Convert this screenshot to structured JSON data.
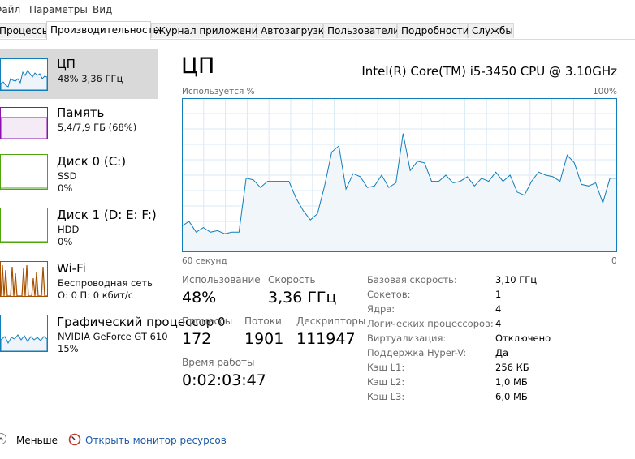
{
  "menubar": {
    "items": [
      "Файл",
      "Параметры",
      "Вид"
    ]
  },
  "tabs": [
    "Процессы",
    "Производительность",
    "Журнал приложений",
    "Автозагрузка",
    "Пользователи",
    "Подробности",
    "Службы"
  ],
  "sidebar": {
    "items": [
      {
        "title": "ЦП",
        "line1": "48% 3,36 ГГц",
        "line2": ""
      },
      {
        "title": "Память",
        "line1": "5,4/7,9 ГБ (68%)",
        "line2": ""
      },
      {
        "title": "Диск 0 (C:)",
        "line1": "SSD",
        "line2": "0%"
      },
      {
        "title": "Диск 1 (D: E: F:)",
        "line1": "HDD",
        "line2": "0%"
      },
      {
        "title": "Wi-Fi",
        "line1": "Беспроводная сеть",
        "line2": "О: 0 П: 0 кбит/с"
      },
      {
        "title": "Графический процессор 0",
        "line1": "NVIDIA GeForce GT 610",
        "line2": "15%"
      }
    ]
  },
  "main": {
    "title": "ЦП",
    "cpu_name": "Intel(R) Core(TM) i5-3450 CPU @ 3.10GHz",
    "chart_label_left": "Используется %",
    "chart_label_right": "100%",
    "chart_time_left": "60 секунд",
    "chart_time_right": "0"
  },
  "stats": {
    "usage_label": "Использование",
    "usage_value": "48%",
    "speed_label": "Скорость",
    "speed_value": "3,36 ГГц",
    "processes_label": "Процессы",
    "processes_value": "172",
    "threads_label": "Потоки",
    "threads_value": "1901",
    "handles_label": "Дескрипторы",
    "handles_value": "111947",
    "uptime_label": "Время работы",
    "uptime_value": "0:02:03:47"
  },
  "details": [
    {
      "key": "Базовая скорость:",
      "value": "3,10 ГГц"
    },
    {
      "key": "Сокетов:",
      "value": "1"
    },
    {
      "key": "Ядра:",
      "value": "4"
    },
    {
      "key": "Логических процессоров:",
      "value": "4"
    },
    {
      "key": "Виртуализация:",
      "value": "Отключено"
    },
    {
      "key": "Поддержка Hyper-V:",
      "value": "Да"
    },
    {
      "key": "Кэш L1:",
      "value": "256 КБ"
    },
    {
      "key": "Кэш L2:",
      "value": "1,0 МБ"
    },
    {
      "key": "Кэш L3:",
      "value": "6,0 МБ"
    }
  ],
  "bottom": {
    "less_label": "Меньше",
    "monitor_label": "Открыть монитор ресурсов"
  },
  "colors": {
    "cpu": "#117dbb",
    "cpu_fill": "#f1f6fa",
    "grid": "#d9eaf4",
    "memory": "#8b12ae",
    "disk": "#4da60c",
    "wifi": "#a74f01",
    "link": "#1a5aa6"
  },
  "chart_data": {
    "type": "area",
    "xlim": [
      60,
      0
    ],
    "ylim": [
      0,
      100
    ],
    "grid": true,
    "values": [
      17,
      20,
      13,
      16,
      13,
      14,
      12,
      13,
      13,
      48,
      47,
      42,
      46,
      46,
      46,
      46,
      35,
      27,
      21,
      25,
      43,
      65,
      69,
      41,
      51,
      49,
      42,
      43,
      50,
      42,
      45,
      77,
      53,
      59,
      58,
      46,
      46,
      50,
      45,
      46,
      49,
      43,
      48,
      46,
      52,
      46,
      50,
      39,
      37,
      46,
      52,
      50,
      49,
      46,
      63,
      58,
      44,
      43,
      45,
      32,
      48,
      48
    ]
  },
  "icons": {
    "less": "chevron-up-icon",
    "monitor": "resource-monitor-icon"
  }
}
